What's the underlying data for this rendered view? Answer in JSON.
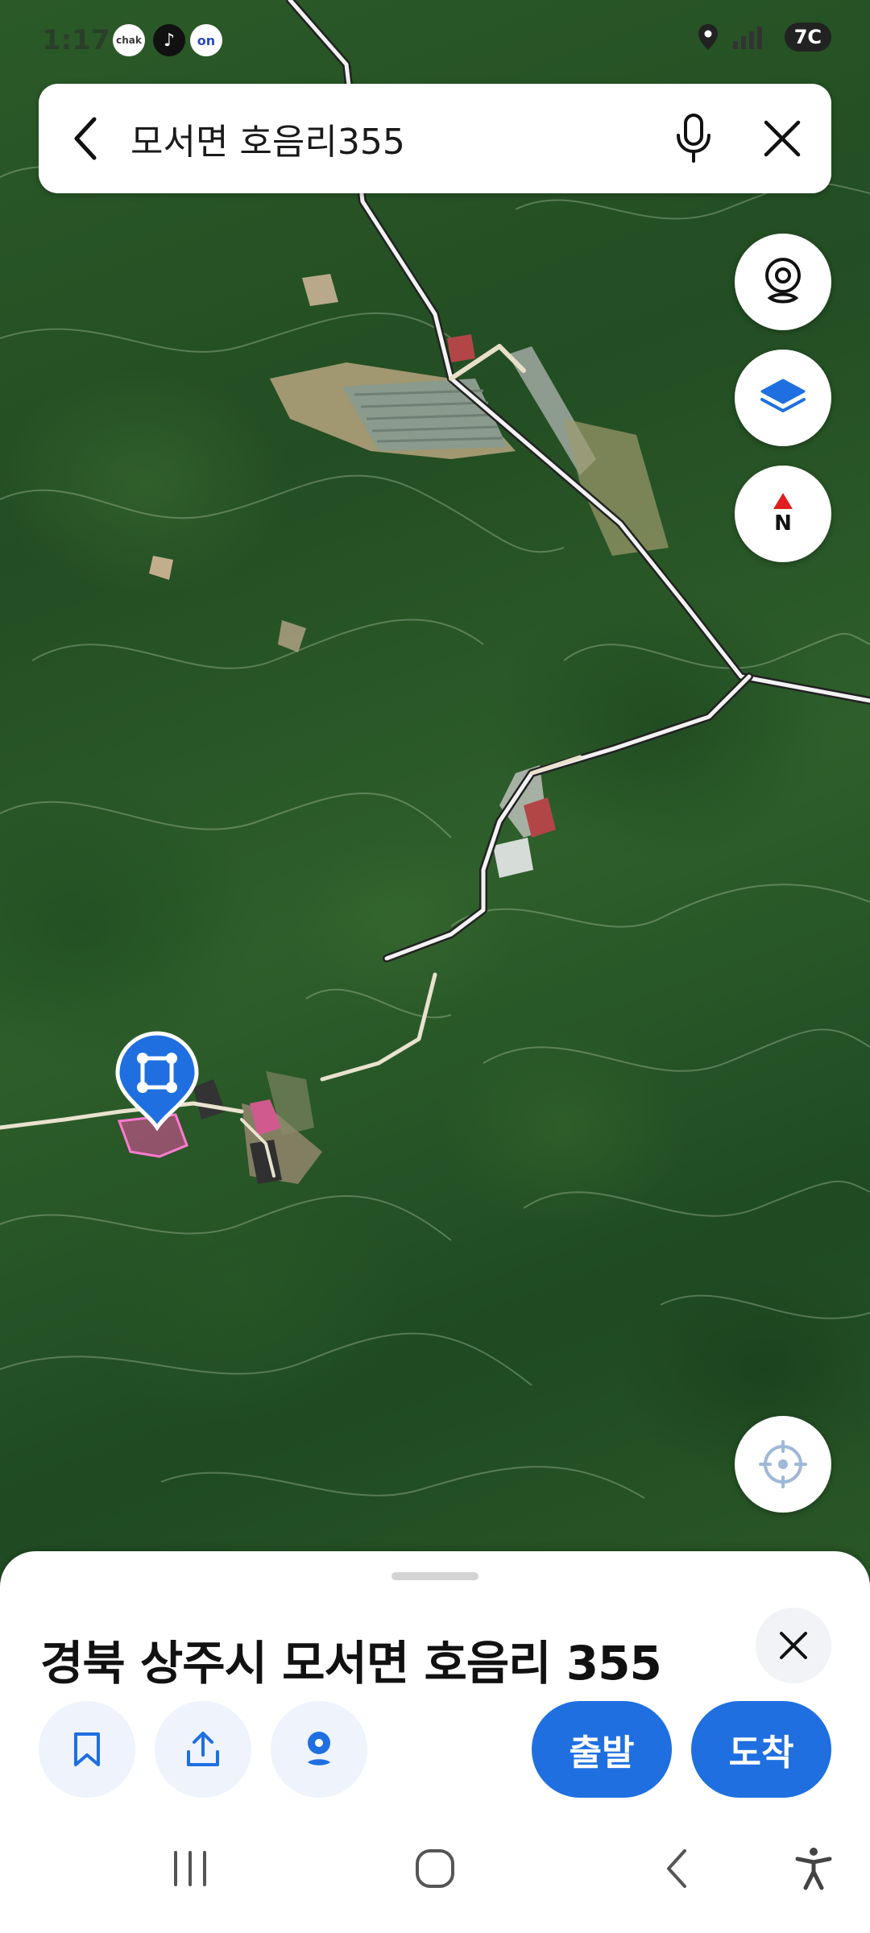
{
  "status_bar": {
    "time": "1:17",
    "apps": [
      "chak",
      "tiktok",
      "on"
    ],
    "indicator": "7C"
  },
  "search": {
    "query": "모서면 호음리355",
    "back_icon": "chevron-left-icon",
    "mic_icon": "microphone-icon",
    "clear_icon": "close-icon"
  },
  "map_controls": {
    "street_view_icon": "street-view-icon",
    "layers_icon": "layers-icon",
    "compass_label": "N",
    "locate_icon": "my-location-icon"
  },
  "place": {
    "address": "경북 상주시 모서면 호음리 355",
    "actions": {
      "save_icon": "bookmark-icon",
      "share_icon": "share-icon",
      "street_view_icon": "street-view-icon"
    },
    "depart_label": "출발",
    "arrive_label": "도착",
    "accent_color": "#1f6fe0"
  },
  "nav_bar": {
    "recent_icon": "recent-apps-icon",
    "home_icon": "home-icon",
    "back_icon": "back-icon",
    "accessibility_icon": "accessibility-icon"
  }
}
